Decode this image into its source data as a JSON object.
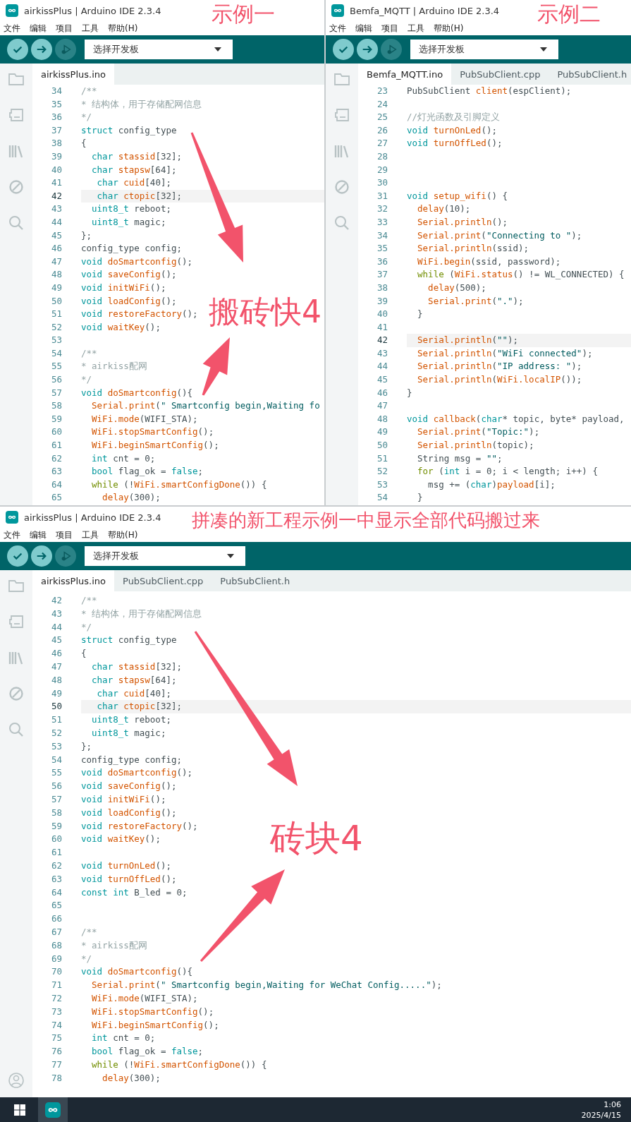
{
  "annotations": [
    "示例一",
    "示例二",
    "搬砖快4",
    "拼凑的新工程示例一中显示全部代码搬过来",
    "砖块4"
  ],
  "windows": [
    {
      "title": "airkissPlus | Arduino IDE 2.3.4",
      "menu": [
        "文件",
        "编辑",
        "项目",
        "工具",
        "帮助(H)"
      ],
      "board_selector": "选择开发板",
      "account_icon": false,
      "tabs": [
        {
          "label": "airkissPlus.ino",
          "selected": true
        }
      ],
      "lines": [
        {
          "number": "34",
          "current": false,
          "segments": [
            {
              "kind": "comment",
              "text": "/**"
            }
          ]
        },
        {
          "number": "35",
          "current": false,
          "segments": [
            {
              "kind": "comment",
              "text": "* 结构体，用于存储配网信息"
            }
          ]
        },
        {
          "number": "36",
          "current": false,
          "segments": [
            {
              "kind": "comment",
              "text": "*/"
            }
          ]
        },
        {
          "number": "37",
          "current": false,
          "segments": [
            {
              "kind": "keyword",
              "text": "struct"
            },
            {
              "kind": "plain",
              "text": " config_type"
            }
          ]
        },
        {
          "number": "38",
          "current": false,
          "segments": [
            {
              "kind": "plain",
              "text": "{"
            }
          ]
        },
        {
          "number": "39",
          "current": false,
          "segments": [
            {
              "kind": "keyword",
              "text": "  char "
            },
            {
              "kind": "function",
              "text": "stassid"
            },
            {
              "kind": "plain",
              "text": "[32];"
            }
          ]
        },
        {
          "number": "40",
          "current": false,
          "segments": [
            {
              "kind": "keyword",
              "text": "  char "
            },
            {
              "kind": "function",
              "text": "stapsw"
            },
            {
              "kind": "plain",
              "text": "[64];"
            }
          ]
        },
        {
          "number": "41",
          "current": false,
          "segments": [
            {
              "kind": "keyword",
              "text": "   char "
            },
            {
              "kind": "function",
              "text": "cuid"
            },
            {
              "kind": "plain",
              "text": "[40];"
            }
          ]
        },
        {
          "number": "42",
          "current": true,
          "segments": [
            {
              "kind": "keyword",
              "text": "   char "
            },
            {
              "kind": "function",
              "text": "ctopic"
            },
            {
              "kind": "plain",
              "text": "[32];"
            }
          ]
        },
        {
          "number": "43",
          "current": false,
          "segments": [
            {
              "kind": "keyword",
              "text": "  uint8_t"
            },
            {
              "kind": "plain",
              "text": " reboot;"
            }
          ]
        },
        {
          "number": "44",
          "current": false,
          "segments": [
            {
              "kind": "keyword",
              "text": "  uint8_t"
            },
            {
              "kind": "plain",
              "text": " magic;"
            }
          ]
        },
        {
          "number": "45",
          "current": false,
          "segments": [
            {
              "kind": "plain",
              "text": "};"
            }
          ]
        },
        {
          "number": "46",
          "current": false,
          "segments": [
            {
              "kind": "plain",
              "text": "config_type config;"
            }
          ]
        },
        {
          "number": "47",
          "current": false,
          "segments": [
            {
              "kind": "keyword",
              "text": "void "
            },
            {
              "kind": "function",
              "text": "doSmartconfig"
            },
            {
              "kind": "plain",
              "text": "();"
            }
          ]
        },
        {
          "number": "48",
          "current": false,
          "segments": [
            {
              "kind": "keyword",
              "text": "void "
            },
            {
              "kind": "function",
              "text": "saveConfig"
            },
            {
              "kind": "plain",
              "text": "();"
            }
          ]
        },
        {
          "number": "49",
          "current": false,
          "segments": [
            {
              "kind": "keyword",
              "text": "void "
            },
            {
              "kind": "function",
              "text": "initWiFi"
            },
            {
              "kind": "plain",
              "text": "();"
            }
          ]
        },
        {
          "number": "50",
          "current": false,
          "segments": [
            {
              "kind": "keyword",
              "text": "void "
            },
            {
              "kind": "function",
              "text": "loadConfig"
            },
            {
              "kind": "plain",
              "text": "();"
            }
          ]
        },
        {
          "number": "51",
          "current": false,
          "segments": [
            {
              "kind": "keyword",
              "text": "void "
            },
            {
              "kind": "function",
              "text": "restoreFactory"
            },
            {
              "kind": "plain",
              "text": "();"
            }
          ]
        },
        {
          "number": "52",
          "current": false,
          "segments": [
            {
              "kind": "keyword",
              "text": "void "
            },
            {
              "kind": "function",
              "text": "waitKey"
            },
            {
              "kind": "plain",
              "text": "();"
            }
          ]
        },
        {
          "number": "53",
          "current": false
        },
        {
          "number": "54",
          "current": false,
          "segments": [
            {
              "kind": "comment",
              "text": "/**"
            }
          ]
        },
        {
          "number": "55",
          "current": false,
          "segments": [
            {
              "kind": "comment",
              "text": "* airkiss配网"
            }
          ]
        },
        {
          "number": "56",
          "current": false,
          "segments": [
            {
              "kind": "comment",
              "text": "*/"
            }
          ]
        },
        {
          "number": "57",
          "current": false,
          "segments": [
            {
              "kind": "keyword",
              "text": "void "
            },
            {
              "kind": "function",
              "text": "doSmartconfig"
            },
            {
              "kind": "plain",
              "text": "(){"
            }
          ]
        },
        {
          "number": "58",
          "current": false,
          "segments": [
            {
              "kind": "function",
              "text": "  Serial.print"
            },
            {
              "kind": "plain",
              "text": "("
            },
            {
              "kind": "string",
              "text": "\" Smartconfig begin,Waiting fo"
            }
          ]
        },
        {
          "number": "59",
          "current": false,
          "segments": [
            {
              "kind": "function",
              "text": "  WiFi.mode"
            },
            {
              "kind": "plain",
              "text": "(WIFI_STA);"
            }
          ]
        },
        {
          "number": "60",
          "current": false,
          "segments": [
            {
              "kind": "function",
              "text": "  WiFi.stopSmartConfig"
            },
            {
              "kind": "plain",
              "text": "();"
            }
          ]
        },
        {
          "number": "61",
          "current": false,
          "segments": [
            {
              "kind": "function",
              "text": "  WiFi.beginSmartConfig"
            },
            {
              "kind": "plain",
              "text": "();"
            }
          ]
        },
        {
          "number": "62",
          "current": false,
          "segments": [
            {
              "kind": "keyword",
              "text": "  int"
            },
            {
              "kind": "plain",
              "text": " cnt = 0;"
            }
          ]
        },
        {
          "number": "63",
          "current": false,
          "segments": [
            {
              "kind": "keyword",
              "text": "  bool"
            },
            {
              "kind": "plain",
              "text": " flag_ok = "
            },
            {
              "kind": "keyword",
              "text": "false"
            },
            {
              "kind": "plain",
              "text": ";"
            }
          ]
        },
        {
          "number": "64",
          "current": false,
          "segments": [
            {
              "kind": "control",
              "text": "  while"
            },
            {
              "kind": "plain",
              "text": " (!"
            },
            {
              "kind": "function",
              "text": "WiFi.smartConfigDone"
            },
            {
              "kind": "plain",
              "text": "()) {"
            }
          ]
        },
        {
          "number": "65",
          "current": false,
          "segments": [
            {
              "kind": "function",
              "text": "    delay"
            },
            {
              "kind": "plain",
              "text": "(300);"
            }
          ]
        }
      ]
    },
    {
      "title": "Bemfa_MQTT | Arduino IDE 2.3.4",
      "menu": [
        "文件",
        "编辑",
        "项目",
        "工具",
        "帮助(H)"
      ],
      "board_selector": "选择开发板",
      "account_icon": false,
      "tabs": [
        {
          "label": "Bemfa_MQTT.ino",
          "selected": true
        },
        {
          "label": "PubSubClient.cpp",
          "selected": false
        },
        {
          "label": "PubSubClient.h",
          "selected": false
        }
      ],
      "lines": [
        {
          "number": "23",
          "current": false,
          "segments": [
            {
              "kind": "plain",
              "text": "PubSubClient "
            },
            {
              "kind": "function",
              "text": "client"
            },
            {
              "kind": "plain",
              "text": "(espClient);"
            }
          ]
        },
        {
          "number": "24",
          "current": false
        },
        {
          "number": "25",
          "current": false,
          "segments": [
            {
              "kind": "comment",
              "text": "//灯光函数及引脚定义"
            }
          ]
        },
        {
          "number": "26",
          "current": false,
          "segments": [
            {
              "kind": "keyword",
              "text": "void "
            },
            {
              "kind": "function",
              "text": "turnOnLed"
            },
            {
              "kind": "plain",
              "text": "();"
            }
          ]
        },
        {
          "number": "27",
          "current": false,
          "segments": [
            {
              "kind": "keyword",
              "text": "void "
            },
            {
              "kind": "function",
              "text": "turnOffLed"
            },
            {
              "kind": "plain",
              "text": "();"
            }
          ]
        },
        {
          "number": "28",
          "current": false
        },
        {
          "number": "29",
          "current": false
        },
        {
          "number": "30",
          "current": false
        },
        {
          "number": "31",
          "current": false,
          "segments": [
            {
              "kind": "keyword",
              "text": "void "
            },
            {
              "kind": "function",
              "text": "setup_wifi"
            },
            {
              "kind": "plain",
              "text": "() {"
            }
          ]
        },
        {
          "number": "32",
          "current": false,
          "segments": [
            {
              "kind": "function",
              "text": "  delay"
            },
            {
              "kind": "plain",
              "text": "(10);"
            }
          ]
        },
        {
          "number": "33",
          "current": false,
          "segments": [
            {
              "kind": "function",
              "text": "  Serial.println"
            },
            {
              "kind": "plain",
              "text": "();"
            }
          ]
        },
        {
          "number": "34",
          "current": false,
          "segments": [
            {
              "kind": "function",
              "text": "  Serial.print"
            },
            {
              "kind": "plain",
              "text": "("
            },
            {
              "kind": "string",
              "text": "\"Connecting to \""
            },
            {
              "kind": "plain",
              "text": ");"
            }
          ]
        },
        {
          "number": "35",
          "current": false,
          "segments": [
            {
              "kind": "function",
              "text": "  Serial.println"
            },
            {
              "kind": "plain",
              "text": "(ssid);"
            }
          ]
        },
        {
          "number": "36",
          "current": false,
          "segments": [
            {
              "kind": "function",
              "text": "  WiFi.begin"
            },
            {
              "kind": "plain",
              "text": "(ssid, password);"
            }
          ]
        },
        {
          "number": "37",
          "current": false,
          "segments": [
            {
              "kind": "control",
              "text": "  while"
            },
            {
              "kind": "plain",
              "text": " ("
            },
            {
              "kind": "function",
              "text": "WiFi.status"
            },
            {
              "kind": "plain",
              "text": "() != WL_CONNECTED) {"
            }
          ]
        },
        {
          "number": "38",
          "current": false,
          "segments": [
            {
              "kind": "function",
              "text": "    delay"
            },
            {
              "kind": "plain",
              "text": "(500);"
            }
          ]
        },
        {
          "number": "39",
          "current": false,
          "segments": [
            {
              "kind": "function",
              "text": "    Serial.print"
            },
            {
              "kind": "plain",
              "text": "("
            },
            {
              "kind": "string",
              "text": "\".\""
            },
            {
              "kind": "plain",
              "text": ");"
            }
          ]
        },
        {
          "number": "40",
          "current": false,
          "segments": [
            {
              "kind": "plain",
              "text": "  }"
            }
          ]
        },
        {
          "number": "41",
          "current": false
        },
        {
          "number": "42",
          "current": true,
          "segments": [
            {
              "kind": "function",
              "text": "  Serial.println"
            },
            {
              "kind": "plain",
              "text": "("
            },
            {
              "kind": "string",
              "text": "\"\""
            },
            {
              "kind": "plain",
              "text": ");"
            }
          ]
        },
        {
          "number": "43",
          "current": false,
          "segments": [
            {
              "kind": "function",
              "text": "  Serial.println"
            },
            {
              "kind": "plain",
              "text": "("
            },
            {
              "kind": "string",
              "text": "\"WiFi connected\""
            },
            {
              "kind": "plain",
              "text": ");"
            }
          ]
        },
        {
          "number": "44",
          "current": false,
          "segments": [
            {
              "kind": "function",
              "text": "  Serial.println"
            },
            {
              "kind": "plain",
              "text": "("
            },
            {
              "kind": "string",
              "text": "\"IP address: \""
            },
            {
              "kind": "plain",
              "text": ");"
            }
          ]
        },
        {
          "number": "45",
          "current": false,
          "segments": [
            {
              "kind": "function",
              "text": "  Serial.println"
            },
            {
              "kind": "plain",
              "text": "("
            },
            {
              "kind": "function",
              "text": "WiFi.localIP"
            },
            {
              "kind": "plain",
              "text": "());"
            }
          ]
        },
        {
          "number": "46",
          "current": false,
          "segments": [
            {
              "kind": "plain",
              "text": "}"
            }
          ]
        },
        {
          "number": "47",
          "current": false
        },
        {
          "number": "48",
          "current": false,
          "segments": [
            {
              "kind": "keyword",
              "text": "void "
            },
            {
              "kind": "function",
              "text": "callback"
            },
            {
              "kind": "plain",
              "text": "("
            },
            {
              "kind": "keyword",
              "text": "char"
            },
            {
              "kind": "plain",
              "text": "* topic, byte* payload,"
            }
          ]
        },
        {
          "number": "49",
          "current": false,
          "segments": [
            {
              "kind": "function",
              "text": "  Serial.print"
            },
            {
              "kind": "plain",
              "text": "("
            },
            {
              "kind": "string",
              "text": "\"Topic:\""
            },
            {
              "kind": "plain",
              "text": ");"
            }
          ]
        },
        {
          "number": "50",
          "current": false,
          "segments": [
            {
              "kind": "function",
              "text": "  Serial.println"
            },
            {
              "kind": "plain",
              "text": "(topic);"
            }
          ]
        },
        {
          "number": "51",
          "current": false,
          "segments": [
            {
              "kind": "plain",
              "text": "  String msg = "
            },
            {
              "kind": "string",
              "text": "\"\""
            },
            {
              "kind": "plain",
              "text": ";"
            }
          ]
        },
        {
          "number": "52",
          "current": false,
          "segments": [
            {
              "kind": "control",
              "text": "  for"
            },
            {
              "kind": "plain",
              "text": " ("
            },
            {
              "kind": "keyword",
              "text": "int"
            },
            {
              "kind": "plain",
              "text": " i = 0; i < length; i++) {"
            }
          ]
        },
        {
          "number": "53",
          "current": false,
          "segments": [
            {
              "kind": "plain",
              "text": "    msg += ("
            },
            {
              "kind": "keyword",
              "text": "char"
            },
            {
              "kind": "plain",
              "text": ")"
            },
            {
              "kind": "function",
              "text": "payload"
            },
            {
              "kind": "plain",
              "text": "[i];"
            }
          ]
        },
        {
          "number": "54",
          "current": false,
          "segments": [
            {
              "kind": "plain",
              "text": "  }"
            }
          ]
        }
      ]
    },
    {
      "title": "airkissPlus | Arduino IDE 2.3.4",
      "menu": [
        "文件",
        "编辑",
        "项目",
        "工具",
        "帮助(H)"
      ],
      "board_selector": "选择开发板",
      "account_icon": true,
      "tabs": [
        {
          "label": "airkissPlus.ino",
          "selected": true
        },
        {
          "label": "PubSubClient.cpp",
          "selected": false
        },
        {
          "label": "PubSubClient.h",
          "selected": false
        }
      ],
      "lines": [
        {
          "number": "42",
          "current": false,
          "segments": [
            {
              "kind": "comment",
              "text": "/**"
            }
          ]
        },
        {
          "number": "43",
          "current": false,
          "segments": [
            {
              "kind": "comment",
              "text": "* 结构体，用于存储配网信息"
            }
          ]
        },
        {
          "number": "44",
          "current": false,
          "segments": [
            {
              "kind": "comment",
              "text": "*/"
            }
          ]
        },
        {
          "number": "45",
          "current": false,
          "segments": [
            {
              "kind": "keyword",
              "text": "struct"
            },
            {
              "kind": "plain",
              "text": " config_type"
            }
          ]
        },
        {
          "number": "46",
          "current": false,
          "segments": [
            {
              "kind": "plain",
              "text": "{"
            }
          ]
        },
        {
          "number": "47",
          "current": false,
          "segments": [
            {
              "kind": "keyword",
              "text": "  char "
            },
            {
              "kind": "function",
              "text": "stassid"
            },
            {
              "kind": "plain",
              "text": "[32];"
            }
          ]
        },
        {
          "number": "48",
          "current": false,
          "segments": [
            {
              "kind": "keyword",
              "text": "  char "
            },
            {
              "kind": "function",
              "text": "stapsw"
            },
            {
              "kind": "plain",
              "text": "[64];"
            }
          ]
        },
        {
          "number": "49",
          "current": false,
          "segments": [
            {
              "kind": "keyword",
              "text": "   char "
            },
            {
              "kind": "function",
              "text": "cuid"
            },
            {
              "kind": "plain",
              "text": "[40];"
            }
          ]
        },
        {
          "number": "50",
          "current": true,
          "segments": [
            {
              "kind": "keyword",
              "text": "   char "
            },
            {
              "kind": "function",
              "text": "ctopic"
            },
            {
              "kind": "plain",
              "text": "[32];"
            }
          ]
        },
        {
          "number": "51",
          "current": false,
          "segments": [
            {
              "kind": "keyword",
              "text": "  uint8_t"
            },
            {
              "kind": "plain",
              "text": " reboot;"
            }
          ]
        },
        {
          "number": "52",
          "current": false,
          "segments": [
            {
              "kind": "keyword",
              "text": "  uint8_t"
            },
            {
              "kind": "plain",
              "text": " magic;"
            }
          ]
        },
        {
          "number": "53",
          "current": false,
          "segments": [
            {
              "kind": "plain",
              "text": "};"
            }
          ]
        },
        {
          "number": "54",
          "current": false,
          "segments": [
            {
              "kind": "plain",
              "text": "config_type config;"
            }
          ]
        },
        {
          "number": "55",
          "current": false,
          "segments": [
            {
              "kind": "keyword",
              "text": "void "
            },
            {
              "kind": "function",
              "text": "doSmartconfig"
            },
            {
              "kind": "plain",
              "text": "();"
            }
          ]
        },
        {
          "number": "56",
          "current": false,
          "segments": [
            {
              "kind": "keyword",
              "text": "void "
            },
            {
              "kind": "function",
              "text": "saveConfig"
            },
            {
              "kind": "plain",
              "text": "();"
            }
          ]
        },
        {
          "number": "57",
          "current": false,
          "segments": [
            {
              "kind": "keyword",
              "text": "void "
            },
            {
              "kind": "function",
              "text": "initWiFi"
            },
            {
              "kind": "plain",
              "text": "();"
            }
          ]
        },
        {
          "number": "58",
          "current": false,
          "segments": [
            {
              "kind": "keyword",
              "text": "void "
            },
            {
              "kind": "function",
              "text": "loadConfig"
            },
            {
              "kind": "plain",
              "text": "();"
            }
          ]
        },
        {
          "number": "59",
          "current": false,
          "segments": [
            {
              "kind": "keyword",
              "text": "void "
            },
            {
              "kind": "function",
              "text": "restoreFactory"
            },
            {
              "kind": "plain",
              "text": "();"
            }
          ]
        },
        {
          "number": "60",
          "current": false,
          "segments": [
            {
              "kind": "keyword",
              "text": "void "
            },
            {
              "kind": "function",
              "text": "waitKey"
            },
            {
              "kind": "plain",
              "text": "();"
            }
          ]
        },
        {
          "number": "61",
          "current": false
        },
        {
          "number": "62",
          "current": false,
          "segments": [
            {
              "kind": "keyword",
              "text": "void "
            },
            {
              "kind": "function",
              "text": "turnOnLed"
            },
            {
              "kind": "plain",
              "text": "();"
            }
          ]
        },
        {
          "number": "63",
          "current": false,
          "segments": [
            {
              "kind": "keyword",
              "text": "void "
            },
            {
              "kind": "function",
              "text": "turnOffLed"
            },
            {
              "kind": "plain",
              "text": "();"
            }
          ]
        },
        {
          "number": "64",
          "current": false,
          "segments": [
            {
              "kind": "keyword",
              "text": "const int"
            },
            {
              "kind": "plain",
              "text": " B_led = 0;"
            }
          ]
        },
        {
          "number": "65",
          "current": false
        },
        {
          "number": "66",
          "current": false
        },
        {
          "number": "67",
          "current": false,
          "segments": [
            {
              "kind": "comment",
              "text": "/**"
            }
          ]
        },
        {
          "number": "68",
          "current": false,
          "segments": [
            {
              "kind": "comment",
              "text": "* airkiss配网"
            }
          ]
        },
        {
          "number": "69",
          "current": false,
          "segments": [
            {
              "kind": "comment",
              "text": "*/"
            }
          ]
        },
        {
          "number": "70",
          "current": false,
          "segments": [
            {
              "kind": "keyword",
              "text": "void "
            },
            {
              "kind": "function",
              "text": "doSmartconfig"
            },
            {
              "kind": "plain",
              "text": "(){"
            }
          ]
        },
        {
          "number": "71",
          "current": false,
          "segments": [
            {
              "kind": "function",
              "text": "  Serial.print"
            },
            {
              "kind": "plain",
              "text": "("
            },
            {
              "kind": "string",
              "text": "\" Smartconfig begin,Waiting for WeChat Config.....\""
            },
            {
              "kind": "plain",
              "text": ");"
            }
          ]
        },
        {
          "number": "72",
          "current": false,
          "segments": [
            {
              "kind": "function",
              "text": "  WiFi.mode"
            },
            {
              "kind": "plain",
              "text": "(WIFI_STA);"
            }
          ]
        },
        {
          "number": "73",
          "current": false,
          "segments": [
            {
              "kind": "function",
              "text": "  WiFi.stopSmartConfig"
            },
            {
              "kind": "plain",
              "text": "();"
            }
          ]
        },
        {
          "number": "74",
          "current": false,
          "segments": [
            {
              "kind": "function",
              "text": "  WiFi.beginSmartConfig"
            },
            {
              "kind": "plain",
              "text": "();"
            }
          ]
        },
        {
          "number": "75",
          "current": false,
          "segments": [
            {
              "kind": "keyword",
              "text": "  int"
            },
            {
              "kind": "plain",
              "text": " cnt = 0;"
            }
          ]
        },
        {
          "number": "76",
          "current": false,
          "segments": [
            {
              "kind": "keyword",
              "text": "  bool"
            },
            {
              "kind": "plain",
              "text": " flag_ok = "
            },
            {
              "kind": "keyword",
              "text": "false"
            },
            {
              "kind": "plain",
              "text": ";"
            }
          ]
        },
        {
          "number": "77",
          "current": false,
          "segments": [
            {
              "kind": "control",
              "text": "  while"
            },
            {
              "kind": "plain",
              "text": " (!"
            },
            {
              "kind": "function",
              "text": "WiFi.smartConfigDone"
            },
            {
              "kind": "plain",
              "text": "()) {"
            }
          ]
        },
        {
          "number": "78",
          "current": false,
          "segments": [
            {
              "kind": "function",
              "text": "    delay"
            },
            {
              "kind": "plain",
              "text": "(300);"
            }
          ]
        }
      ]
    }
  ],
  "taskbar": {
    "time": "1:06",
    "date": "2025/4/15"
  }
}
